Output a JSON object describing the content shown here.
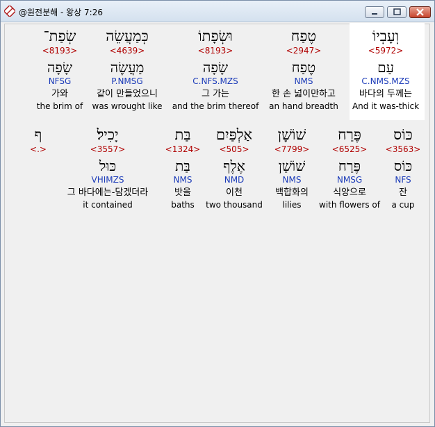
{
  "window": {
    "title": "@원전분해 - 왕상 7:26"
  },
  "row1": [
    {
      "heb": "שְׂפַת־",
      "strong": "<8193>",
      "lemma": "שָׂפָה",
      "morph": "NFSG",
      "kor": "가와",
      "eng": "the brim of"
    },
    {
      "heb": "כְּמַעֲשֵׂה",
      "strong": "<4639>",
      "lemma": "מַעֲשֶׂה",
      "morph": "P.NMSG",
      "kor": "같이 만들었으니",
      "eng": "was wrought like"
    },
    {
      "heb": "וּשְׂפָתוֹ",
      "strong": "<8193>",
      "lemma": "שָׂפָה",
      "morph": "C.NFS.MZS",
      "kor": "그 가는",
      "eng": "and the brim thereof"
    },
    {
      "heb": "טֶפַח",
      "strong": "<2947>",
      "lemma": "טֶפַח",
      "morph": "NMS",
      "kor": "한 손 넓이만하고",
      "eng": "an hand breadth"
    },
    {
      "heb": "וְעָבְיוֹ",
      "strong": "<5972>",
      "lemma": "עַם",
      "morph": "C.NMS.MZS",
      "kor": "바다의 두께는",
      "eng": "And it was-thick"
    }
  ],
  "row2": [
    {
      "heb": "ף",
      "strong": "<.>",
      "lemma": "",
      "morph": "",
      "kor": "",
      "eng": ""
    },
    {
      "heb": "יָכִיל׃",
      "strong": "<3557>",
      "lemma": "כּוּל",
      "morph": "VHIMZS",
      "kor": "그 바다에는-담겠더라",
      "eng": "it contained"
    },
    {
      "heb": "בַּת",
      "strong": "<1324>",
      "lemma": "בַּת",
      "morph": "NMS",
      "kor": "밧을",
      "eng": "baths"
    },
    {
      "heb": "אַלְפַּיִם",
      "strong": "<505>",
      "lemma": "אֶלֶף",
      "morph": "NMD",
      "kor": "이천",
      "eng": "two thousand"
    },
    {
      "heb": "שׁוֹשָׁן",
      "strong": "<7799>",
      "lemma": "שׁוֹשַׁן",
      "morph": "NMS",
      "kor": "백합화의",
      "eng": "lilies"
    },
    {
      "heb": "פֶּרַח",
      "strong": "<6525>",
      "lemma": "פֶּרַח",
      "morph": "NMSG",
      "kor": "식양으로",
      "eng": "with flowers of"
    },
    {
      "heb": "כּוֹס",
      "strong": "<3563>",
      "lemma": "כּוֹס",
      "morph": "NFS",
      "kor": "잔",
      "eng": "a cup"
    }
  ]
}
